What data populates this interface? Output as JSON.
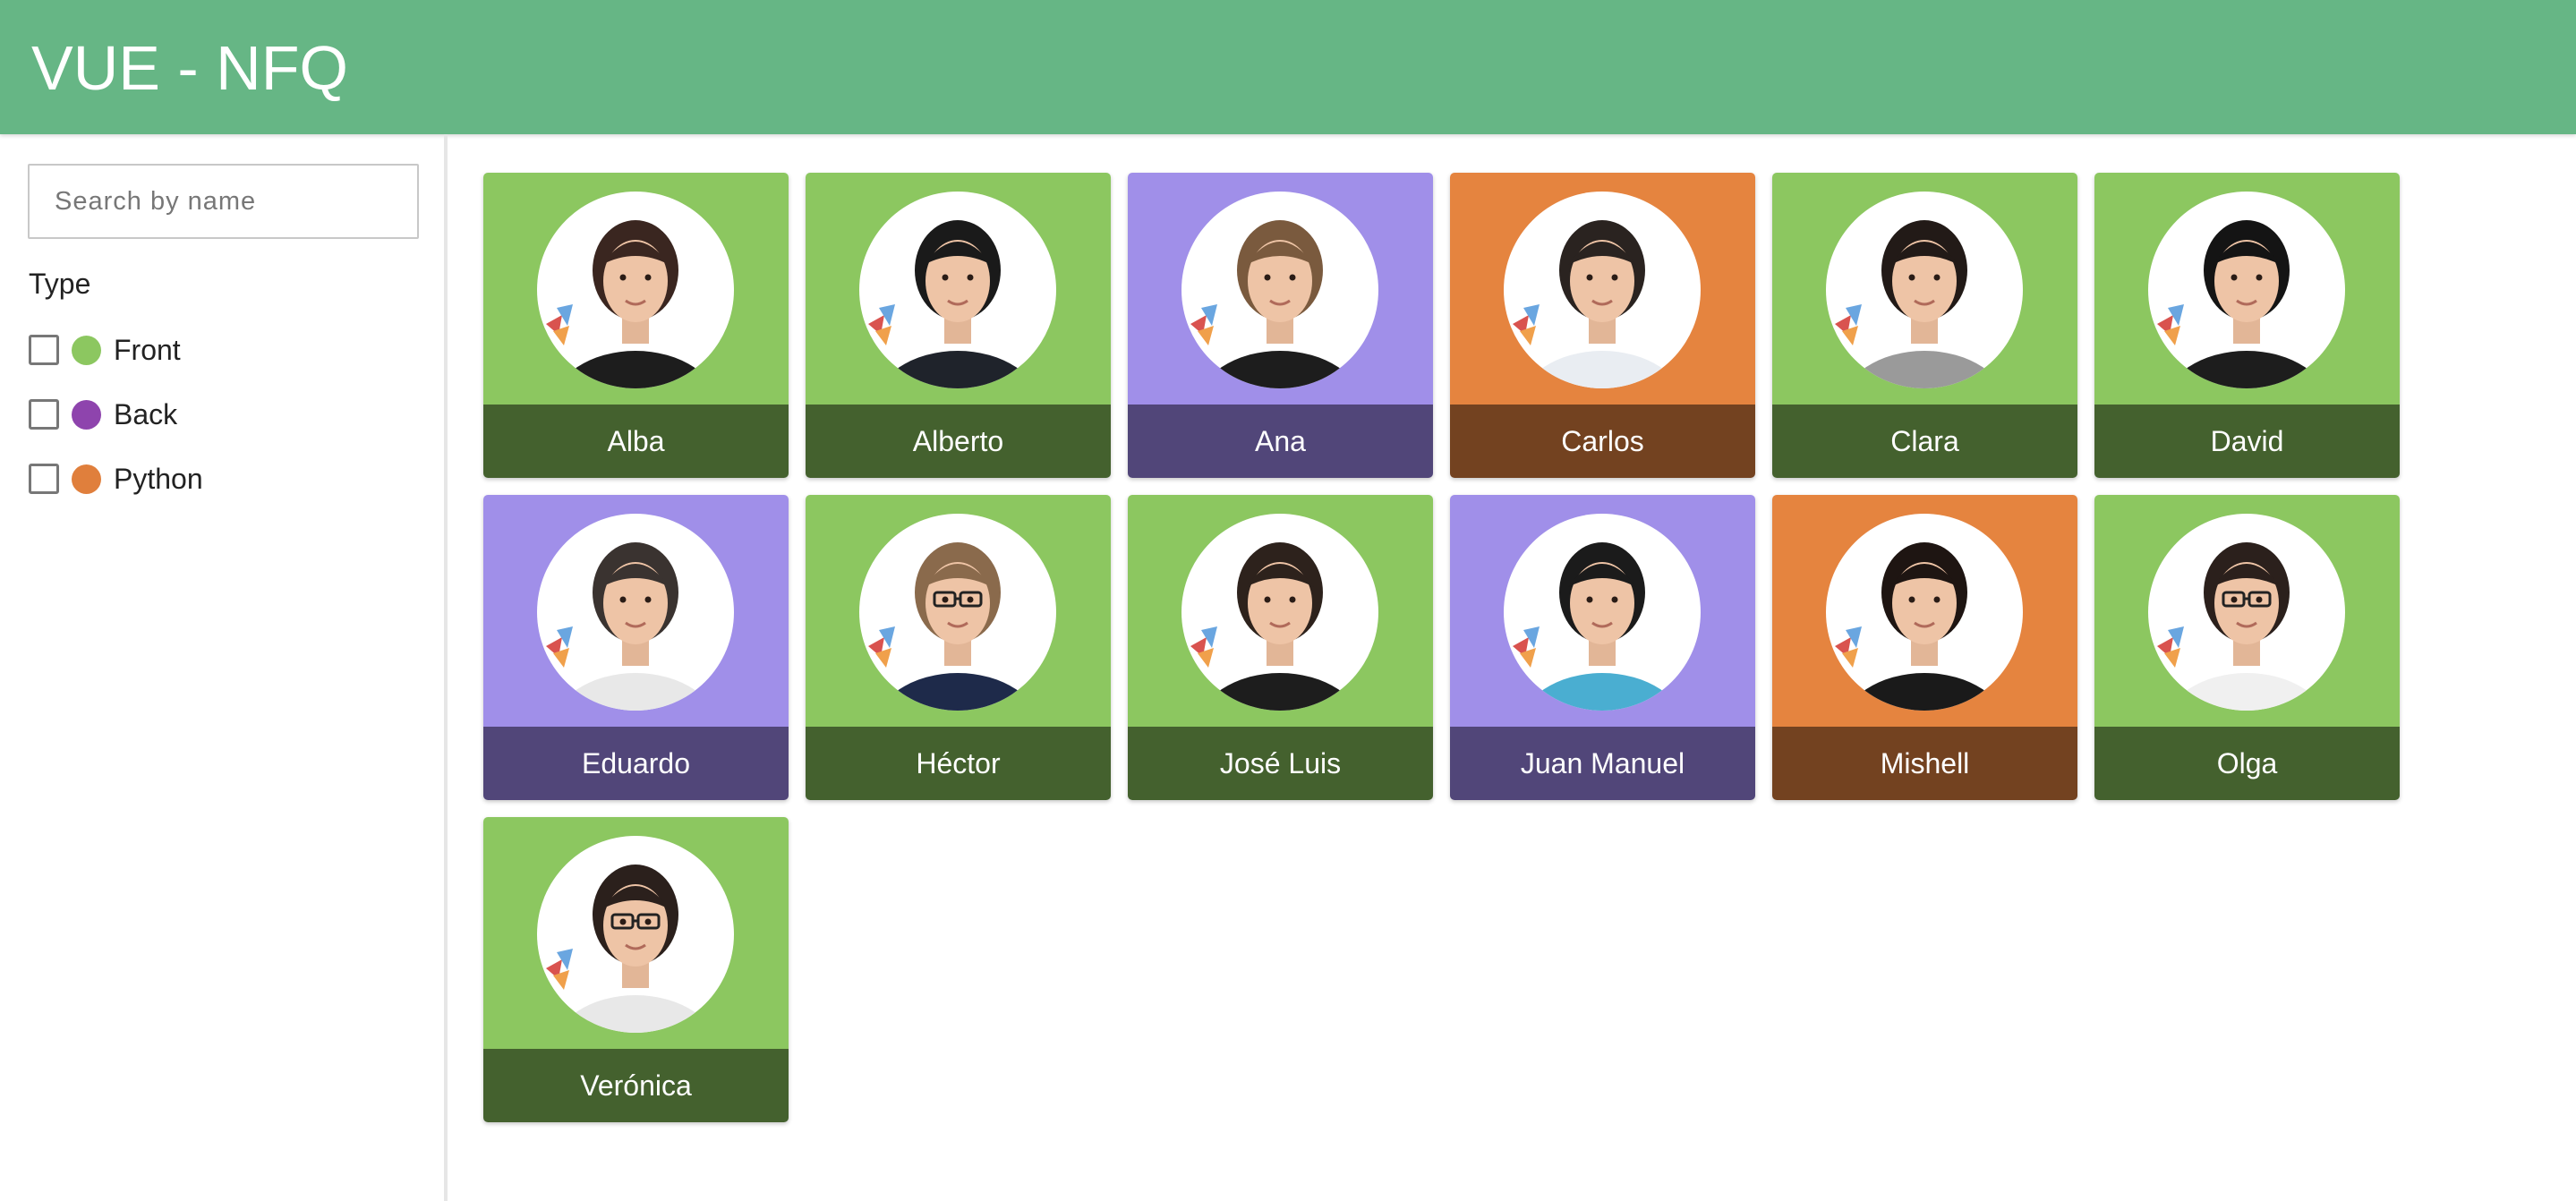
{
  "app": {
    "title": "VUE - NFQ"
  },
  "search": {
    "placeholder": "Search by name",
    "value": ""
  },
  "filters": {
    "title": "Type",
    "options": [
      {
        "label": "Front",
        "color": "#8cc760",
        "checked": false
      },
      {
        "label": "Back",
        "color": "#8e44ad",
        "checked": false
      },
      {
        "label": "Python",
        "color": "#e07f3c",
        "checked": false
      }
    ]
  },
  "types": {
    "Front": {
      "card_color": "#8cc760",
      "label_bg": "#44612e"
    },
    "Back": {
      "card_color": "#a08fe9",
      "label_bg": "#514679"
    },
    "Python": {
      "card_color": "#e5843f",
      "label_bg": "#734220"
    }
  },
  "people": [
    {
      "name": "Alba",
      "type": "Front",
      "hair": "#3a2620",
      "shirt": "#1d1d1d",
      "glasses": false
    },
    {
      "name": "Alberto",
      "type": "Front",
      "hair": "#1a1a1a",
      "shirt": "#1f232b",
      "glasses": false
    },
    {
      "name": "Ana",
      "type": "Back",
      "hair": "#7a5a3e",
      "shirt": "#1d1d1d",
      "glasses": false
    },
    {
      "name": "Carlos",
      "type": "Python",
      "hair": "#2a2320",
      "shirt": "#e9edf2",
      "glasses": false
    },
    {
      "name": "Clara",
      "type": "Front",
      "hair": "#221a17",
      "shirt": "#9a9a9a",
      "glasses": false
    },
    {
      "name": "David",
      "type": "Front",
      "hair": "#141414",
      "shirt": "#1d1d1d",
      "glasses": false
    },
    {
      "name": "Eduardo",
      "type": "Back",
      "hair": "#3a3330",
      "shirt": "#e8e8e8",
      "glasses": false
    },
    {
      "name": "Héctor",
      "type": "Front",
      "hair": "#8a6a4c",
      "shirt": "#1e2a4a",
      "glasses": true
    },
    {
      "name": "José Luis",
      "type": "Front",
      "hair": "#2d221c",
      "shirt": "#1d1d1d",
      "glasses": false
    },
    {
      "name": "Juan Manuel",
      "type": "Back",
      "hair": "#1b1b1b",
      "shirt": "#4aaed1",
      "glasses": false
    },
    {
      "name": "Mishell",
      "type": "Python",
      "hair": "#1e1512",
      "shirt": "#1a1a1a",
      "glasses": false
    },
    {
      "name": "Olga",
      "type": "Front",
      "hair": "#2b201c",
      "shirt": "#f0f0f0",
      "glasses": true
    },
    {
      "name": "Verónica",
      "type": "Front",
      "hair": "#2b201c",
      "shirt": "#e8e8e8",
      "glasses": true
    }
  ]
}
